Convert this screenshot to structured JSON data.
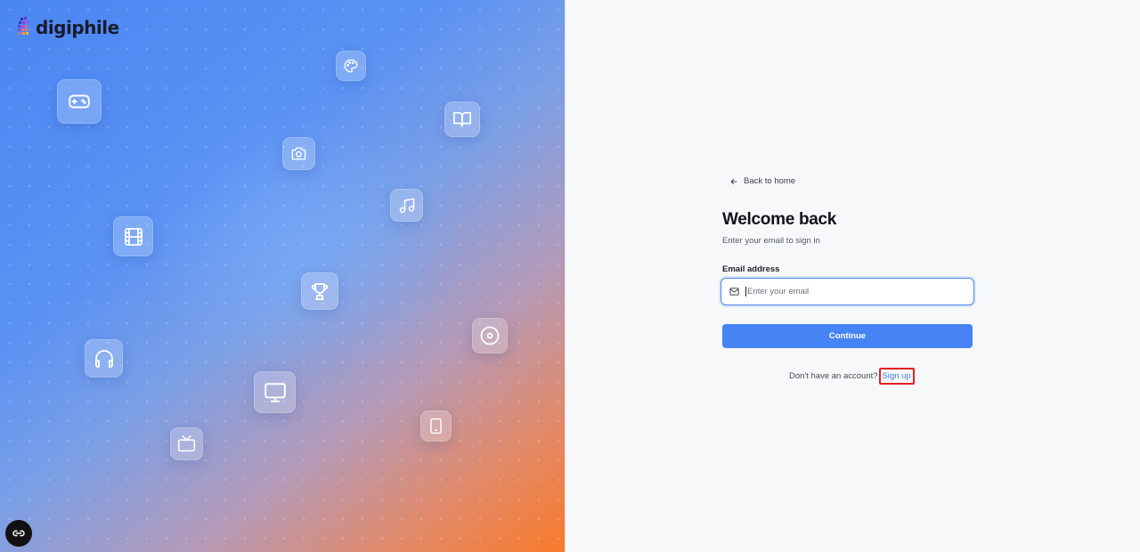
{
  "brand": {
    "name": "digiphile"
  },
  "hero_tiles": [
    {
      "icon": "palette-icon"
    },
    {
      "icon": "gamepad-icon"
    },
    {
      "icon": "book-icon"
    },
    {
      "icon": "camera-icon"
    },
    {
      "icon": "music-icon"
    },
    {
      "icon": "film-icon"
    },
    {
      "icon": "trophy-icon"
    },
    {
      "icon": "disc-icon"
    },
    {
      "icon": "headphones-icon"
    },
    {
      "icon": "monitor-icon"
    },
    {
      "icon": "tablet-icon"
    },
    {
      "icon": "tv-icon"
    }
  ],
  "login": {
    "back_label": "Back to home",
    "title": "Welcome back",
    "subtitle": "Enter your email to sign in",
    "email_label": "Email address",
    "email_placeholder": "Enter your email",
    "email_value": "",
    "continue_label": "Continue",
    "no_account_text": "Don't have an account?",
    "signup_label": "Sign up"
  },
  "colors": {
    "accent": "#4584f2",
    "highlight": "#e0211f",
    "gradient_start": "#4a86f2",
    "gradient_end": "#f97a2a"
  }
}
